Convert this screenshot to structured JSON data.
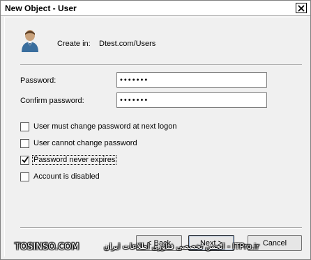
{
  "window": {
    "title": "New Object - User"
  },
  "header": {
    "create_in_label": "Create in:",
    "create_in_value": "Dtest.com/Users"
  },
  "fields": {
    "password_label": "Password:",
    "password_value": "•••••••",
    "confirm_label": "Confirm password:",
    "confirm_value": "•••••••"
  },
  "options": [
    {
      "label": "User must change password at next logon",
      "checked": false
    },
    {
      "label": "User cannot change password",
      "checked": false
    },
    {
      "label": "Password never expires",
      "checked": true
    },
    {
      "label": "Account is disabled",
      "checked": false
    }
  ],
  "buttons": {
    "back": "< Back",
    "next": "Next >",
    "cancel": "Cancel"
  },
  "watermark": {
    "left": "TOSINSO.COM",
    "right": "ITPro.ir - انجمن تخصصی فناوری اطلاعات ایران"
  },
  "icons": {
    "close": "close-icon",
    "user": "user-icon",
    "check": "checkmark-icon"
  }
}
